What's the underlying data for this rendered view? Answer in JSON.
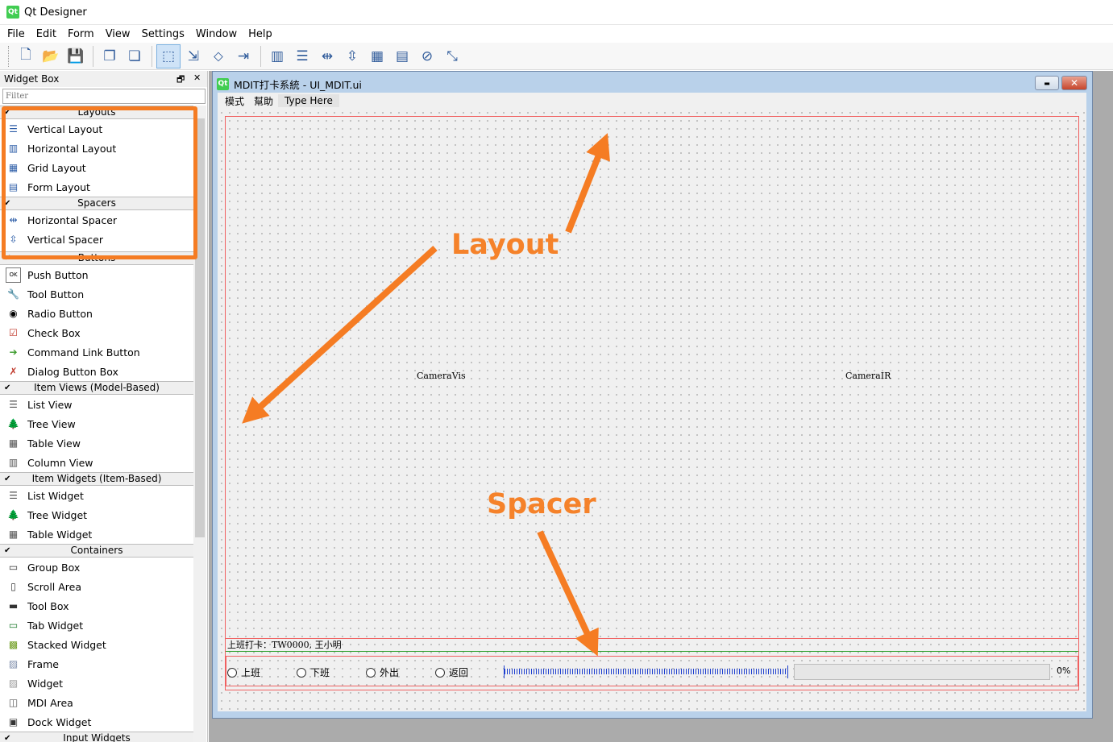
{
  "app": {
    "title": "Qt Designer"
  },
  "menu": [
    "File",
    "Edit",
    "Form",
    "View",
    "Settings",
    "Window",
    "Help"
  ],
  "toolbar": {
    "buttons": [
      {
        "icon": "new-file-icon",
        "glyph": "🗋"
      },
      {
        "icon": "open-folder-icon",
        "glyph": "📂"
      },
      {
        "icon": "save-icon",
        "glyph": "💾"
      },
      {
        "icon": "send-to-back-icon",
        "glyph": "❐"
      },
      {
        "icon": "bring-to-front-icon",
        "glyph": "❏"
      },
      {
        "icon": "edit-widgets-icon",
        "glyph": "⬚"
      },
      {
        "icon": "edit-signals-icon",
        "glyph": "⇲"
      },
      {
        "icon": "edit-buddies-icon",
        "glyph": "⬦"
      },
      {
        "icon": "edit-tab-order-icon",
        "glyph": "⇥"
      },
      {
        "icon": "lay-out-horizontally-icon",
        "glyph": "▥"
      },
      {
        "icon": "lay-out-vertically-icon",
        "glyph": "☰"
      },
      {
        "icon": "lay-out-horizontal-splitter-icon",
        "glyph": "⇹"
      },
      {
        "icon": "lay-out-vertical-splitter-icon",
        "glyph": "⇳"
      },
      {
        "icon": "lay-out-grid-icon",
        "glyph": "▦"
      },
      {
        "icon": "lay-out-form-icon",
        "glyph": "▤"
      },
      {
        "icon": "break-layout-icon",
        "glyph": "⊘"
      },
      {
        "icon": "adjust-size-icon",
        "glyph": "⤡"
      }
    ]
  },
  "widget_box": {
    "title": "Widget Box",
    "float_glyph": "🗗",
    "close_glyph": "✕",
    "filter_placeholder": "Filter",
    "groups": [
      {
        "name": "Layouts",
        "items": [
          {
            "label": "Vertical Layout",
            "icon": "vertical-layout-icon",
            "glyph": "☰"
          },
          {
            "label": "Horizontal Layout",
            "icon": "horizontal-layout-icon",
            "glyph": "▥"
          },
          {
            "label": "Grid Layout",
            "icon": "grid-layout-icon",
            "glyph": "▦"
          },
          {
            "label": "Form Layout",
            "icon": "form-layout-icon",
            "glyph": "▤"
          }
        ]
      },
      {
        "name": "Spacers",
        "items": [
          {
            "label": "Horizontal Spacer",
            "icon": "horizontal-spacer-icon",
            "glyph": "⇹"
          },
          {
            "label": "Vertical Spacer",
            "icon": "vertical-spacer-icon",
            "glyph": "⇳"
          }
        ]
      },
      {
        "name": "Buttons",
        "items": [
          {
            "label": "Push Button",
            "icon": "push-button-icon",
            "glyph": "OK"
          },
          {
            "label": "Tool Button",
            "icon": "tool-button-icon",
            "glyph": "🔧"
          },
          {
            "label": "Radio Button",
            "icon": "radio-button-icon",
            "glyph": "◉"
          },
          {
            "label": "Check Box",
            "icon": "check-box-icon",
            "glyph": "☑"
          },
          {
            "label": "Command Link Button",
            "icon": "command-link-button-icon",
            "glyph": "➔"
          },
          {
            "label": "Dialog Button Box",
            "icon": "dialog-button-box-icon",
            "glyph": "✗"
          }
        ]
      },
      {
        "name": "Item Views (Model-Based)",
        "items": [
          {
            "label": "List View",
            "icon": "list-view-icon",
            "glyph": "☰"
          },
          {
            "label": "Tree View",
            "icon": "tree-view-icon",
            "glyph": "🌲"
          },
          {
            "label": "Table View",
            "icon": "table-view-icon",
            "glyph": "▦"
          },
          {
            "label": "Column View",
            "icon": "column-view-icon",
            "glyph": "▥"
          }
        ]
      },
      {
        "name": "Item Widgets (Item-Based)",
        "items": [
          {
            "label": "List Widget",
            "icon": "list-widget-icon",
            "glyph": "☰"
          },
          {
            "label": "Tree Widget",
            "icon": "tree-widget-icon",
            "glyph": "🌲"
          },
          {
            "label": "Table Widget",
            "icon": "table-widget-icon",
            "glyph": "▦"
          }
        ]
      },
      {
        "name": "Containers",
        "items": [
          {
            "label": "Group Box",
            "icon": "group-box-icon",
            "glyph": "▭"
          },
          {
            "label": "Scroll Area",
            "icon": "scroll-area-icon",
            "glyph": "▯"
          },
          {
            "label": "Tool Box",
            "icon": "tool-box-icon",
            "glyph": "▬"
          },
          {
            "label": "Tab Widget",
            "icon": "tab-widget-icon",
            "glyph": "▭"
          },
          {
            "label": "Stacked Widget",
            "icon": "stacked-widget-icon",
            "glyph": "▩"
          },
          {
            "label": "Frame",
            "icon": "frame-icon",
            "glyph": "▨"
          },
          {
            "label": "Widget",
            "icon": "widget-icon",
            "glyph": "▨"
          },
          {
            "label": "MDI Area",
            "icon": "mdi-area-icon",
            "glyph": "◫"
          },
          {
            "label": "Dock Widget",
            "icon": "dock-widget-icon",
            "glyph": "▣"
          }
        ]
      },
      {
        "name": "Input Widgets",
        "items": []
      }
    ]
  },
  "form": {
    "window_title": "MDIT打卡系統 - UI_MDIT.ui",
    "menu": [
      "模式",
      "幫助"
    ],
    "type_here": "Type Here",
    "camera_left": "CameraVis",
    "camera_right": "CameraIR",
    "status_text": "上班打卡：TW0000, 王小明",
    "radios": [
      "上班",
      "下班",
      "外出",
      "返回"
    ],
    "progress": {
      "value": 0,
      "text": "0%"
    },
    "minimize_glyph": "▬",
    "close_glyph": "✕"
  },
  "annotations": {
    "layout": "Layout",
    "spacer": "Spacer",
    "accent": "#f57c23"
  }
}
